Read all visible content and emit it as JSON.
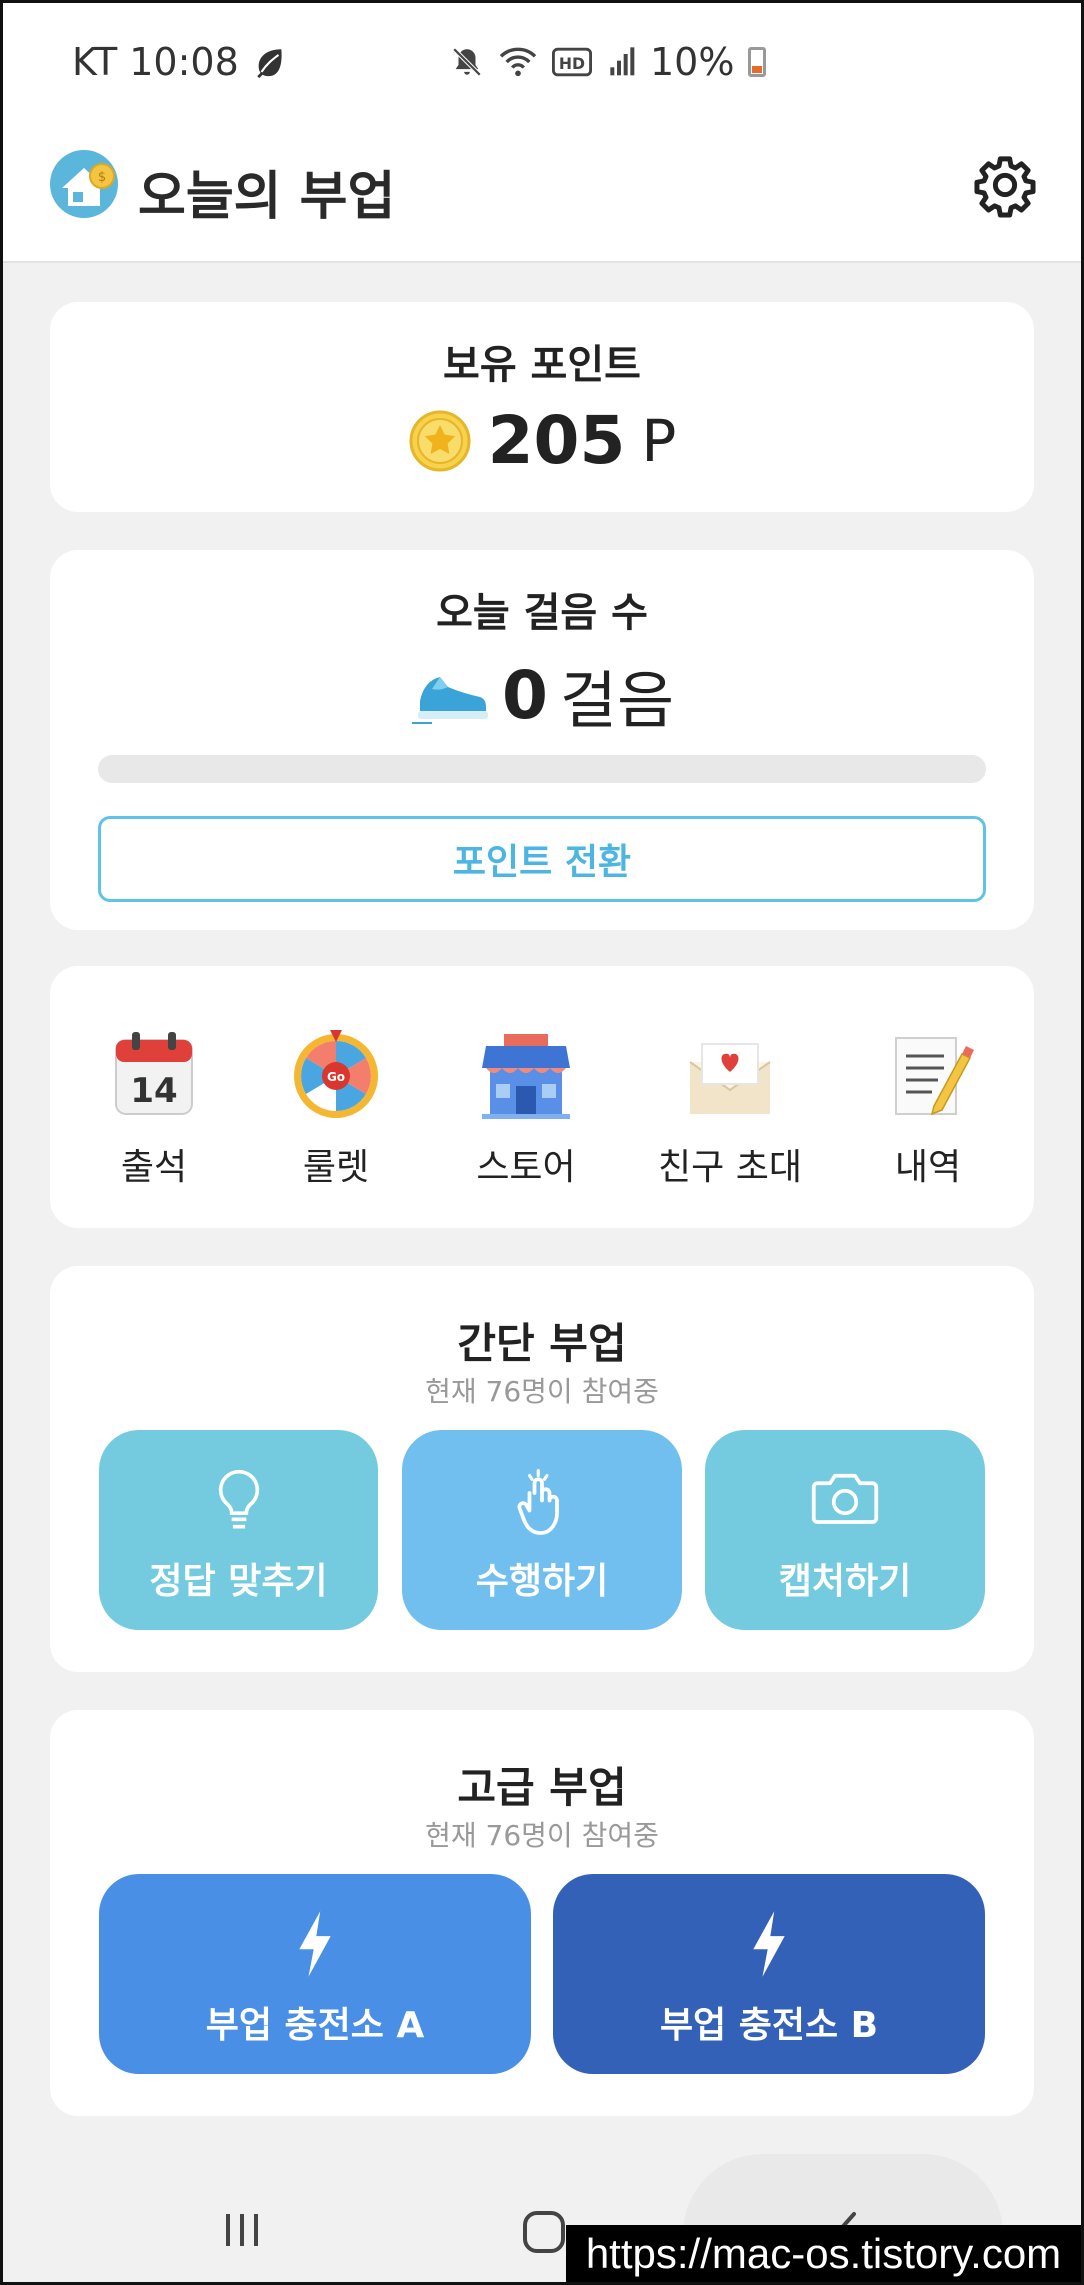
{
  "status_bar": {
    "carrier_time": "KT 10:08",
    "battery": "10%",
    "icons": [
      "leaf-icon",
      "mute-icon",
      "wifi-icon",
      "hd-icon",
      "signal-icon",
      "battery-icon"
    ]
  },
  "app": {
    "title": "오늘의 부업",
    "icons": [
      "app-logo",
      "gear-icon"
    ]
  },
  "points": {
    "label": "보유 포인트",
    "value": "205",
    "unit": "P",
    "icon": "star-coin-icon"
  },
  "steps": {
    "label": "오늘 걸음 수",
    "value": "0",
    "unit": "걸음",
    "icon": "sneaker-icon",
    "progress_fraction": 0,
    "convert_button": "포인트 전환"
  },
  "menu": {
    "items": [
      {
        "label": "출석",
        "icon": "calendar-icon"
      },
      {
        "label": "룰렛",
        "icon": "roulette-icon"
      },
      {
        "label": "스토어",
        "icon": "store-icon"
      },
      {
        "label": "친구 초대",
        "icon": "envelope-heart-icon"
      },
      {
        "label": "내역",
        "icon": "notepad-icon"
      }
    ]
  },
  "simple_side_job": {
    "title": "간단 부업",
    "subtitle": "현재 76명이 참여중",
    "tiles": [
      {
        "label": "정답 맞추기",
        "icon": "lightbulb-icon",
        "color": "#74cbe0"
      },
      {
        "label": "수행하기",
        "icon": "tap-hand-icon",
        "color": "#70bfef"
      },
      {
        "label": "캡처하기",
        "icon": "camera-icon",
        "color": "#74cbe0"
      }
    ]
  },
  "advanced_side_job": {
    "title": "고급 부업",
    "subtitle": "현재 76명이 참여중",
    "tiles": [
      {
        "label": "부업 충전소 A",
        "icon": "lightning-icon",
        "color": "#4a8fe6"
      },
      {
        "label": "부업 충전소 B",
        "icon": "lightning-icon",
        "color": "#3461b8"
      }
    ]
  },
  "nav": {
    "icons": [
      "recent-apps-icon",
      "home-icon",
      "back-icon"
    ]
  },
  "watermark": "https://mac-os.tistory.com"
}
